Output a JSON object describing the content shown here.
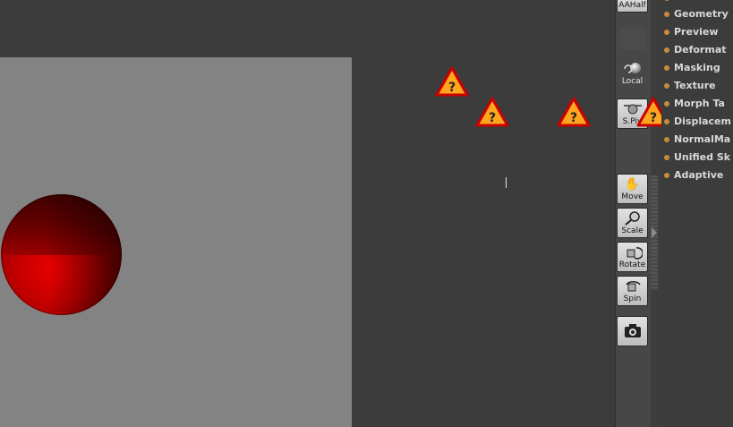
{
  "toolbar": {
    "aahalf_label": "AAHalf",
    "local_label": "Local",
    "spivot_label": "S.Piv",
    "move_label": "Move",
    "scale_label": "Scale",
    "rotate_label": "Rotate",
    "spin_label": "Spin"
  },
  "warning_glyph": "?",
  "menu": {
    "items": [
      {
        "label": "Geometry"
      },
      {
        "label": "Preview"
      },
      {
        "label": "Deformat"
      },
      {
        "label": "Masking"
      },
      {
        "label": "Texture"
      },
      {
        "label": "Morph Ta"
      },
      {
        "label": "Displacem"
      },
      {
        "label": "NormalMa"
      },
      {
        "label": "Unified Sk"
      },
      {
        "label": "Adaptive"
      }
    ],
    "dot_color": "#c98a3c"
  },
  "colors": {
    "canvas": "#838383",
    "background": "#3a3a3a",
    "sphere": "#c20000",
    "warning_fill": "#ffa51e",
    "warning_stroke": "#c80000"
  }
}
